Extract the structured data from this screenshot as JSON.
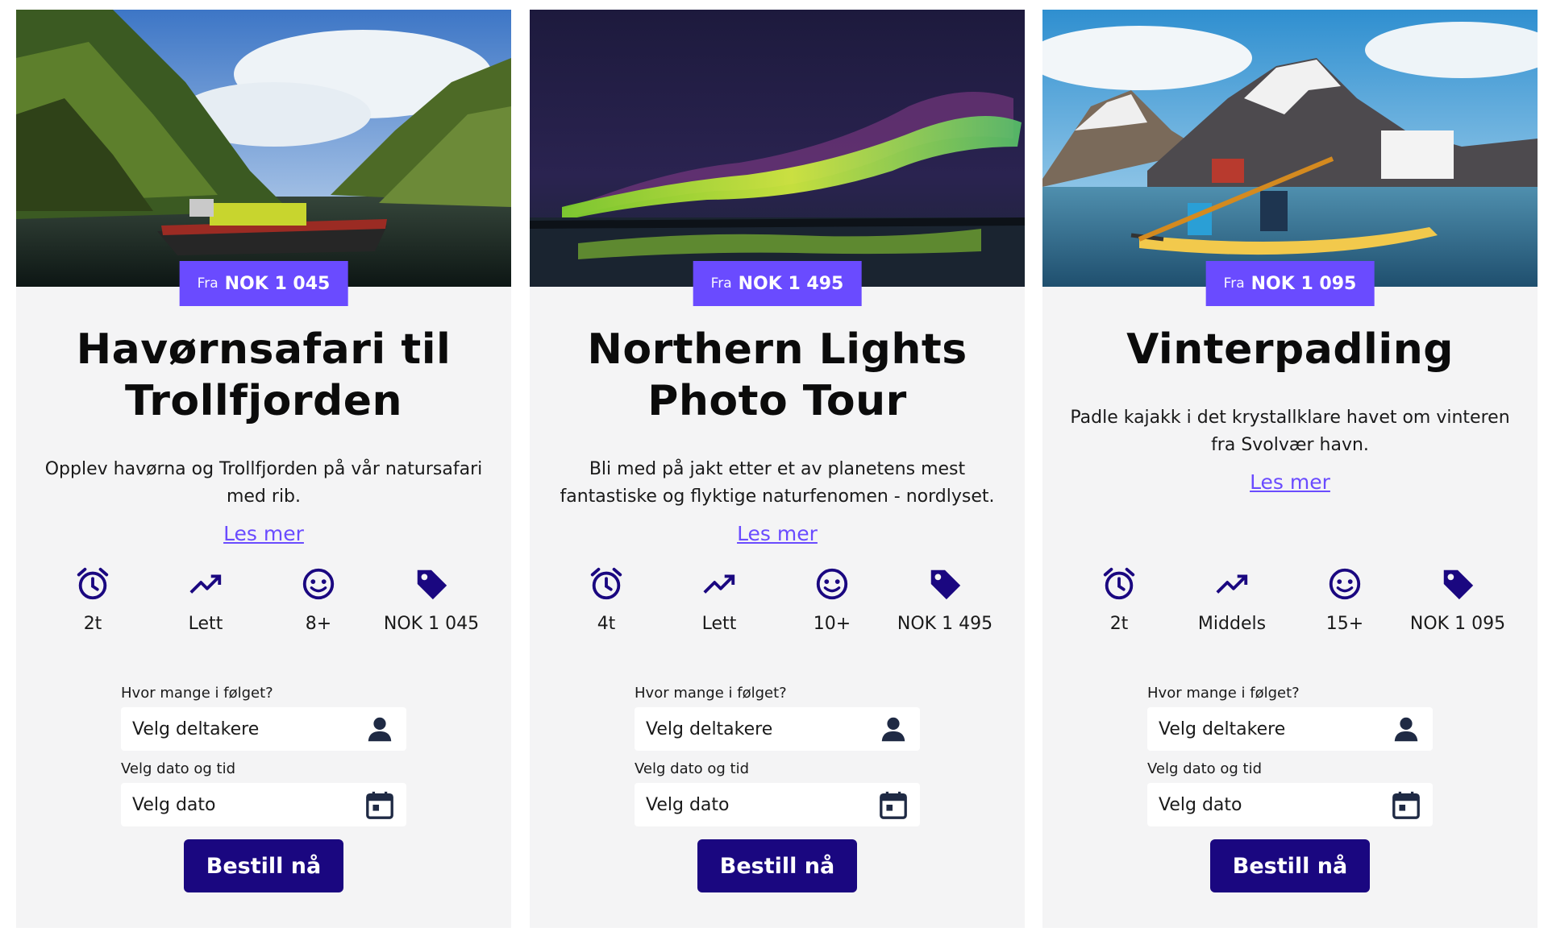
{
  "icons": {
    "duration": "alarm-clock-icon",
    "difficulty": "trending-up-icon",
    "age": "smiley-face-icon",
    "price": "price-tag-icon",
    "person": "person-icon",
    "calendar": "calendar-icon"
  },
  "colors": {
    "accent": "#6a4bff",
    "button": "#1a0780",
    "icon": "#1a0780",
    "card_bg": "#f4f4f5"
  },
  "cards": [
    {
      "image": "boat-fjord-photo",
      "price_prefix": "Fra",
      "price_value": "NOK 1 045",
      "title": "Havørnsafari til Trollfjorden",
      "description": "Opplev havørna og Trollfjorden på vår natursafari med rib.",
      "read_more": "Les mer",
      "facts": {
        "duration": "2t",
        "difficulty": "Lett",
        "age": "8+",
        "price": "NOK 1 045"
      },
      "participants_label": "Hvor mange i følget?",
      "participants_placeholder": "Velg deltakere",
      "date_label": "Velg dato og tid",
      "date_placeholder": "Velg dato",
      "button": "Bestill nå"
    },
    {
      "image": "northern-lights-photo",
      "price_prefix": "Fra",
      "price_value": "NOK 1 495",
      "title": "Northern Lights Photo Tour",
      "description": "Bli med på jakt etter et av planetens mest fantastiske og flyktige naturfenomen - nordlyset.",
      "read_more": "Les mer",
      "facts": {
        "duration": "4t",
        "difficulty": "Lett",
        "age": "10+",
        "price": "NOK 1 495"
      },
      "participants_label": "Hvor mange i følget?",
      "participants_placeholder": "Velg deltakere",
      "date_label": "Velg dato og tid",
      "date_placeholder": "Velg dato",
      "button": "Bestill nå"
    },
    {
      "image": "kayak-mountain-photo",
      "price_prefix": "Fra",
      "price_value": "NOK 1 095",
      "title": "Vinterpadling",
      "description": "Padle kajakk i det krystallklare havet om vinteren fra Svolvær havn.",
      "read_more": "Les mer",
      "facts": {
        "duration": "2t",
        "difficulty": "Middels",
        "age": "15+",
        "price": "NOK 1 095"
      },
      "participants_label": "Hvor mange i følget?",
      "participants_placeholder": "Velg deltakere",
      "date_label": "Velg dato og tid",
      "date_placeholder": "Velg dato",
      "button": "Bestill nå"
    }
  ]
}
